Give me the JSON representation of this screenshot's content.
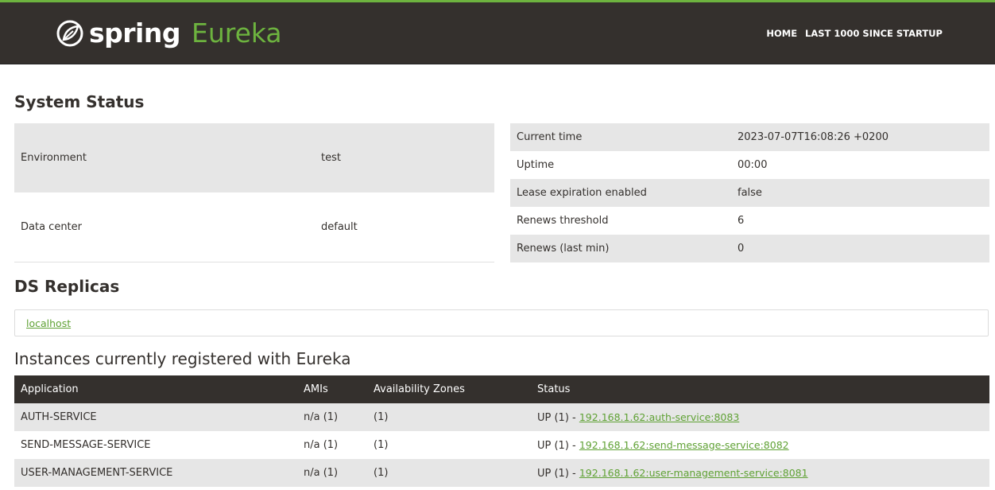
{
  "brand": {
    "spring": "spring",
    "eureka": "Eureka"
  },
  "nav": {
    "home": "HOME",
    "last1000": "LAST 1000 SINCE STARTUP"
  },
  "system_status": {
    "title": "System Status",
    "left": [
      {
        "key": "Environment",
        "value": "test"
      },
      {
        "key": "Data center",
        "value": "default"
      }
    ],
    "right": [
      {
        "key": "Current time",
        "value": "2023-07-07T16:08:26 +0200"
      },
      {
        "key": "Uptime",
        "value": "00:00"
      },
      {
        "key": "Lease expiration enabled",
        "value": "false"
      },
      {
        "key": "Renews threshold",
        "value": "6"
      },
      {
        "key": "Renews (last min)",
        "value": "0"
      }
    ]
  },
  "ds_replicas": {
    "title": "DS Replicas",
    "link": "localhost"
  },
  "instances": {
    "title": "Instances currently registered with Eureka",
    "headers": [
      "Application",
      "AMIs",
      "Availability Zones",
      "Status"
    ],
    "rows": [
      {
        "application": "AUTH-SERVICE",
        "amis": "n/a (1)",
        "zones": "(1)",
        "status_prefix": "UP (1) - ",
        "status_link": "192.168.1.62:auth-service:8083"
      },
      {
        "application": "SEND-MESSAGE-SERVICE",
        "amis": "n/a (1)",
        "zones": "(1)",
        "status_prefix": "UP (1) - ",
        "status_link": "192.168.1.62:send-message-service:8082"
      },
      {
        "application": "USER-MANAGEMENT-SERVICE",
        "amis": "n/a (1)",
        "zones": "(1)",
        "status_prefix": "UP (1) - ",
        "status_link": "192.168.1.62:user-management-service:8081"
      }
    ]
  },
  "colors": {
    "brand_green": "#6db33f",
    "header_dark": "#34302d",
    "row_alt": "#e6e6e6"
  }
}
